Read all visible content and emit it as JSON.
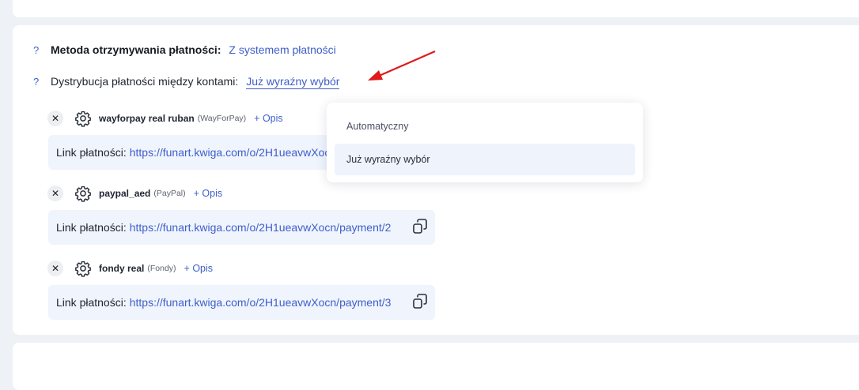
{
  "method_row": {
    "label": "Metoda otrzymywania płatności:",
    "value": "Z systemem płatności"
  },
  "distribution_row": {
    "label": "Dystrybucja płatności między kontami:",
    "value": "Już wyraźny wybór"
  },
  "methods": [
    {
      "name": "wayforpay real ruban",
      "provider": "(WayForPay)",
      "opis": "+ Opis",
      "link_label": "Link płatności:",
      "url": "https://funart.kwiga.com/o/2H1ueavwXocn/payment/1"
    },
    {
      "name": "paypal_aed",
      "provider": "(PayPal)",
      "opis": "+ Opis",
      "link_label": "Link płatności:",
      "url": "https://funart.kwiga.com/o/2H1ueavwXocn/payment/2"
    },
    {
      "name": "fondy real",
      "provider": "(Fondy)",
      "opis": "+ Opis",
      "link_label": "Link płatności:",
      "url": "https://funart.kwiga.com/o/2H1ueavwXocn/payment/3"
    }
  ],
  "dropdown": {
    "options": [
      "Automatyczny",
      "Już wyraźny wybór"
    ],
    "selected": "Już wyraźny wybór"
  },
  "help_icon": "question-mark-icon",
  "colors": {
    "accent": "#3f5ec9",
    "arrow": "#e0191b",
    "link_box": "#eff4fd"
  }
}
